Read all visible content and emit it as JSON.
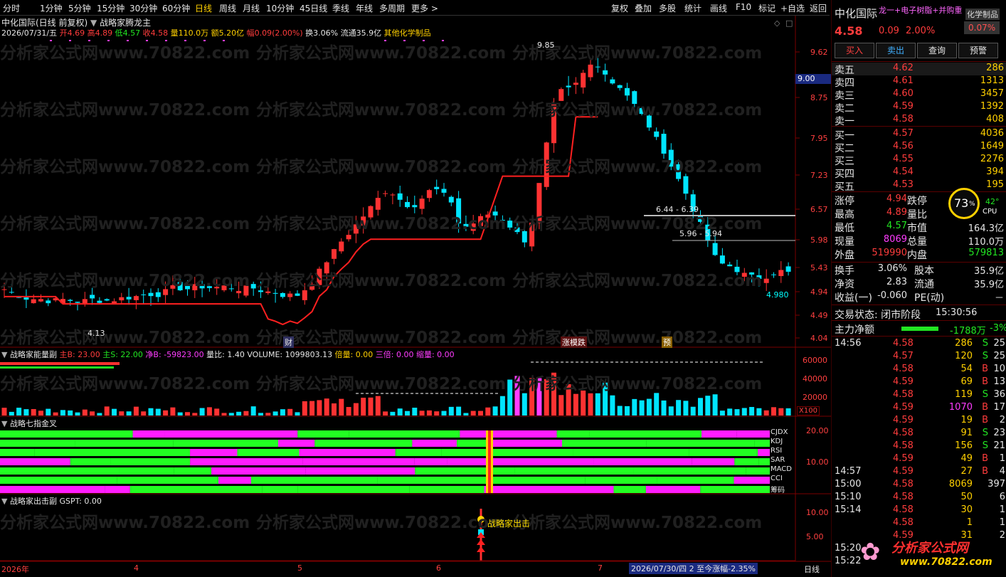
{
  "toolbar": {
    "left": [
      "分时",
      "1分钟",
      "5分钟",
      "15分钟",
      "30分钟",
      "60分钟",
      "日线",
      "周线",
      "月线",
      "10分钟",
      "45日线",
      "季线",
      "年线",
      "多周期",
      "更多 >"
    ],
    "active_index": 6,
    "right": [
      "复权",
      "叠加",
      "多股",
      "统计",
      "画线",
      "F10",
      "标记",
      "+自选",
      "返回"
    ]
  },
  "chart": {
    "title": "中化国际(日线 前复权)",
    "indicator": "战略家腾龙主",
    "date": "2026/07/31/五",
    "open": "开4.69",
    "high": "高4.89",
    "low": "低4.57",
    "close": "收4.58",
    "volume": "量110.0万",
    "amount": "额5.20亿",
    "change": "幅0.09(2.00%)",
    "turnover": "换3.06%",
    "float": "流通35.9亿",
    "sector": "其他化学制品",
    "price_axis": [
      "9.62",
      "8.75",
      "7.95",
      "7.23",
      "6.57",
      "5.98",
      "5.43",
      "4.94",
      "4.49",
      "4.04"
    ],
    "current_tag": "9.00",
    "annotations": {
      "high": "9.85",
      "low": "4.13",
      "range1": "6.44 - 6.39",
      "range2": "5.96 - 5.94",
      "last": "4.980"
    },
    "markers": {
      "cai": "财",
      "zt": "涨模跌",
      "yu": "预"
    }
  },
  "vol_panel": {
    "name": "战略家能量副",
    "main_b": "主B: 23.00",
    "main_s": "主S: 22.00",
    "net_b": "净B: -59823.00",
    "ratio": "量比: 1.40",
    "volume": "VOLUME: 1099803.13",
    "bei": "倍量: 0.00",
    "san": "三倍: 0.00",
    "suo": "缩量: 0.00",
    "axis": [
      "60000",
      "40000",
      "20000"
    ],
    "unit": "X100"
  },
  "seven_panel": {
    "name": "战略七指金叉",
    "rows": [
      "CJDX",
      "KDJ",
      "RSI",
      "SAR",
      "MACD",
      "CCI",
      "筹码"
    ],
    "axis": [
      "20.00",
      "10.00"
    ]
  },
  "strike_panel": {
    "name": "战略家出击副",
    "value": "GSPT: 0.00",
    "label": "战略家出击",
    "axis": [
      "10.00",
      "5.00"
    ]
  },
  "timeline": {
    "labels": [
      "2026年",
      "4",
      "5",
      "6",
      "7"
    ],
    "status": "2026/07/30/四 2 至今涨幅-2.35%",
    "period": "日线"
  },
  "quote": {
    "name": "中化国际",
    "tags": "龙一+电子树脂+并购重",
    "industry": "化学制品",
    "price": "4.58",
    "chg": "0.09",
    "pct": "2.00%",
    "badge": "0.07%",
    "buttons": [
      "买入",
      "卖出",
      "查询",
      "预警"
    ],
    "asks": [
      {
        "label": "卖五",
        "price": "4.62",
        "vol": "286"
      },
      {
        "label": "卖四",
        "price": "4.61",
        "vol": "1313"
      },
      {
        "label": "卖三",
        "price": "4.60",
        "vol": "3457"
      },
      {
        "label": "卖二",
        "price": "4.59",
        "vol": "1392"
      },
      {
        "label": "卖一",
        "price": "4.58",
        "vol": "408"
      }
    ],
    "bids": [
      {
        "label": "买一",
        "price": "4.57",
        "vol": "4036"
      },
      {
        "label": "买二",
        "price": "4.56",
        "vol": "1649"
      },
      {
        "label": "买三",
        "price": "4.55",
        "vol": "2276"
      },
      {
        "label": "买四",
        "price": "4.54",
        "vol": "394"
      },
      {
        "label": "买五",
        "price": "4.53",
        "vol": "195"
      }
    ],
    "stats": [
      {
        "l1": "涨停",
        "v1": "4.94",
        "l2": "跌停",
        "v2": "4"
      },
      {
        "l1": "最高",
        "v1": "4.89",
        "l2": "量比",
        "v2": "1"
      },
      {
        "l1": "最低",
        "v1": "4.57",
        "l2": "市值",
        "v2": "164.3亿"
      },
      {
        "l1": "现量",
        "v1": "8069",
        "l2": "总量",
        "v2": "110.0万"
      },
      {
        "l1": "外盘",
        "v1": "519990",
        "l2": "内盘",
        "v2": "579813"
      }
    ],
    "stats2": [
      {
        "l1": "换手",
        "v1": "3.06%",
        "l2": "股本",
        "v2": "35.9亿"
      },
      {
        "l1": "净资",
        "v1": "2.83",
        "l2": "流通",
        "v2": "35.9亿"
      },
      {
        "l1": "收益(一)",
        "v1": "-0.060",
        "l2": "PE(动)",
        "v2": "－"
      }
    ],
    "gauge": {
      "pct": "73",
      "unit": "%",
      "temp": "42°",
      "cpu": "CPU"
    },
    "trade_state": "交易状态: 闭市阶段",
    "trade_time": "15:30:56",
    "netflow_label": "主力净额",
    "netflow_value": "-1788万",
    "netflow_pct": "-3%",
    "ticks": [
      {
        "t": "14:56",
        "p": "4.58",
        "v": "286",
        "d": "S",
        "n": "25"
      },
      {
        "t": "",
        "p": "4.57",
        "v": "120",
        "d": "S",
        "n": "25"
      },
      {
        "t": "",
        "p": "4.58",
        "v": "54",
        "d": "B",
        "n": "10"
      },
      {
        "t": "",
        "p": "4.59",
        "v": "69",
        "d": "B",
        "n": "13"
      },
      {
        "t": "",
        "p": "4.58",
        "v": "119",
        "d": "S",
        "n": "36"
      },
      {
        "t": "",
        "p": "4.59",
        "v": "1070",
        "d": "B",
        "n": "17"
      },
      {
        "t": "",
        "p": "4.59",
        "v": "19",
        "d": "B",
        "n": "2"
      },
      {
        "t": "",
        "p": "4.58",
        "v": "91",
        "d": "S",
        "n": "23"
      },
      {
        "t": "",
        "p": "4.58",
        "v": "156",
        "d": "S",
        "n": "21"
      },
      {
        "t": "",
        "p": "4.59",
        "v": "49",
        "d": "B",
        "n": "1"
      },
      {
        "t": "14:57",
        "p": "4.59",
        "v": "27",
        "d": "B",
        "n": "4"
      },
      {
        "t": "15:00",
        "p": "4.58",
        "v": "8069",
        "d": "",
        "n": "397"
      },
      {
        "t": "15:10",
        "p": "4.58",
        "v": "50",
        "d": "",
        "n": "6"
      },
      {
        "t": "15:14",
        "p": "4.58",
        "v": "30",
        "d": "",
        "n": "1"
      },
      {
        "t": "",
        "p": "4.58",
        "v": "1",
        "d": "",
        "n": "1"
      },
      {
        "t": "",
        "p": "4.59",
        "v": "31",
        "d": "",
        "n": "2"
      },
      {
        "t": "15:20",
        "p": "",
        "v": "",
        "d": "",
        "n": ""
      },
      {
        "t": "15:22",
        "p": "",
        "v": "",
        "d": "",
        "n": ""
      }
    ],
    "logo_text": "分析家公式网",
    "logo_url": "www.70822.com"
  },
  "watermark": "分析家公式网www.70822.com"
}
